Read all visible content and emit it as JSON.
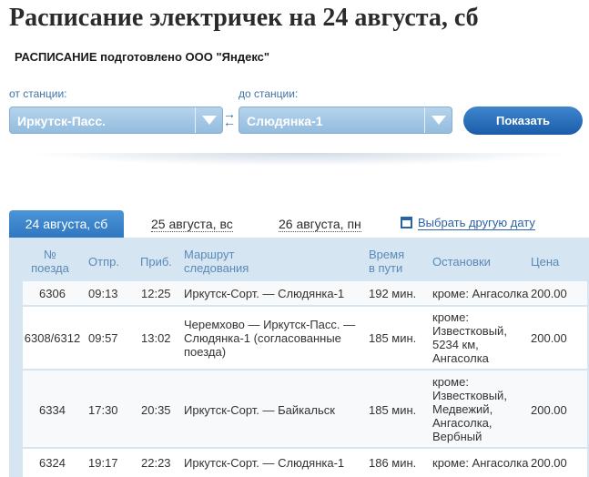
{
  "page_title": "Расписание электричек на 24 августа, сб",
  "subtitle": "РАСПИСАНИЕ подготовлено ООО \"Яндекс\"",
  "form": {
    "from_label": "от станции:",
    "from_value": "Иркутск-Пасс.",
    "to_label": "до станции:",
    "to_value": "Слюдянка-1",
    "swap_icon": "swap-arrows-icon",
    "show_button": "Показать"
  },
  "tabs": [
    {
      "label": "24 августа, сб",
      "active": true
    },
    {
      "label": "25 августа, вс",
      "active": false
    },
    {
      "label": "26 августа, пн",
      "active": false
    }
  ],
  "other_date_link": "Выбрать другую дату",
  "table": {
    "headers": {
      "train_no_l1": "№",
      "train_no_l2": "поезда",
      "departure": "Отпр.",
      "arrival": "Приб.",
      "route_l1": "Маршрут",
      "route_l2": "следования",
      "duration_l1": "Время",
      "duration_l2": "в пути",
      "stops": "Остановки",
      "price": "Цена"
    },
    "rows": [
      {
        "train": "6306",
        "dep": "09:13",
        "arr": "12:25",
        "route": [
          "Иркутск-Сорт. — Слюдянка-1"
        ],
        "duration": "192 мин.",
        "stops": [
          "кроме: Ангасолка"
        ],
        "price": "200.00"
      },
      {
        "train": "6308/6312",
        "dep": "09:57",
        "arr": "13:02",
        "route": [
          "Черемхово — Иркутск-Пасс. —",
          "Слюдянка-1 (согласованные",
          "поезда)"
        ],
        "duration": "185 мин.",
        "stops": [
          "кроме:",
          "Известковый,",
          "5234 км,",
          "Ангасолка"
        ],
        "price": "200.00"
      },
      {
        "train": "6334",
        "dep": "17:30",
        "arr": "20:35",
        "route": [
          "Иркутск-Сорт. — Байкальск"
        ],
        "duration": "185 мин.",
        "stops": [
          "кроме:",
          "Известковый,",
          "Медвежий,",
          "Ангасолка,",
          "Вербный"
        ],
        "price": "200.00"
      },
      {
        "train": "6324",
        "dep": "19:17",
        "arr": "22:23",
        "route": [
          "Иркутск-Сорт. — Слюдянка-1"
        ],
        "duration": "186 мин.",
        "stops": [
          "кроме: Ангасолка"
        ],
        "price": "200.00"
      }
    ]
  }
}
